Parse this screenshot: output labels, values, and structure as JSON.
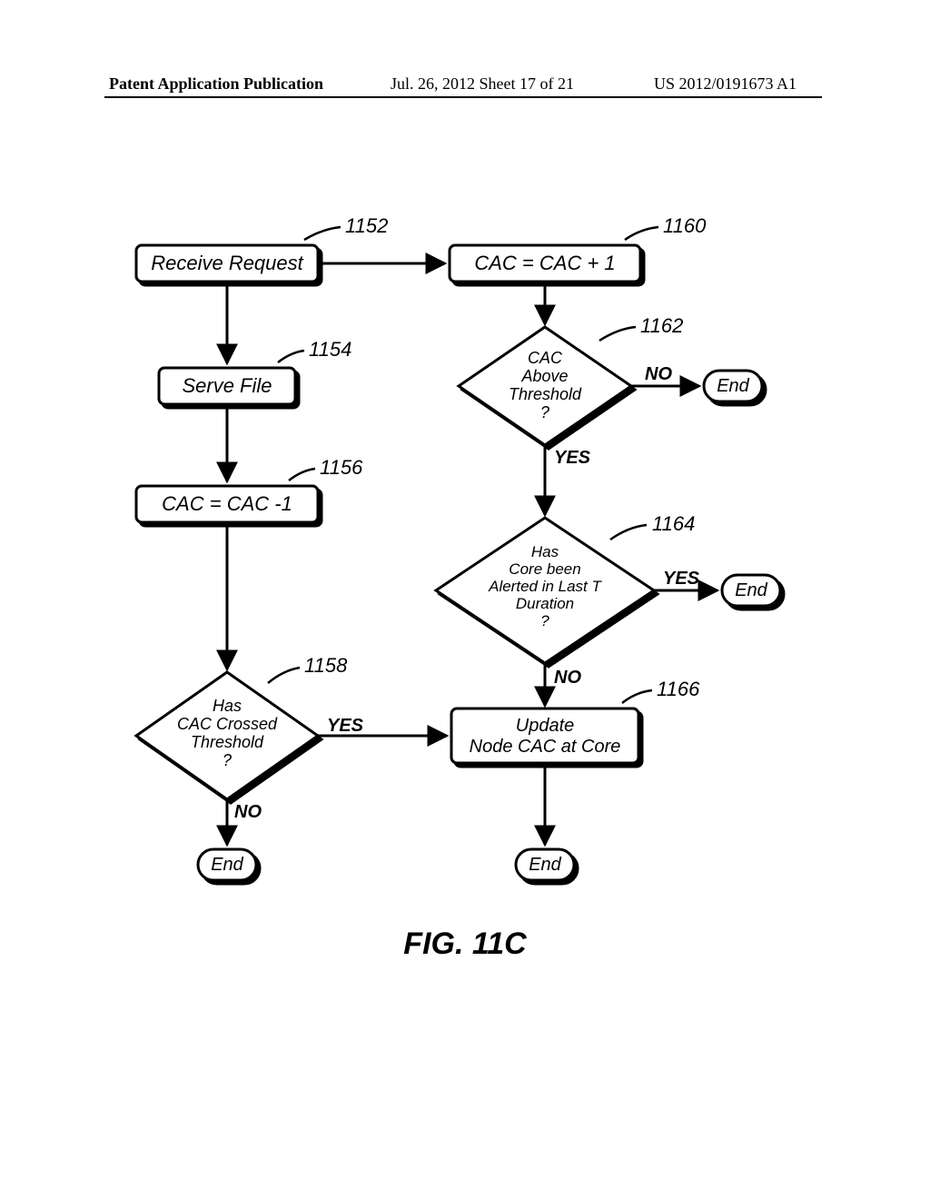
{
  "header": {
    "left": "Patent Application Publication",
    "mid": "Jul. 26, 2012  Sheet 17 of 21",
    "right": "US 2012/0191673 A1"
  },
  "figure_caption": "FIG. 11C",
  "labels": {
    "l1152": "1152",
    "l1154": "1154",
    "l1156": "1156",
    "l1158": "1158",
    "l1160": "1160",
    "l1162": "1162",
    "l1164": "1164",
    "l1166": "1166"
  },
  "nodes": {
    "receive_request": "Receive Request",
    "serve_file": "Serve File",
    "cac_minus": "CAC = CAC -1",
    "cac_plus": "CAC = CAC + 1",
    "d1158_l1": "Has",
    "d1158_l2": "CAC Crossed",
    "d1158_l3": "Threshold",
    "d1158_l4": "?",
    "d1162_l1": "CAC",
    "d1162_l2": "Above",
    "d1162_l3": "Threshold",
    "d1162_l4": "?",
    "d1164_l1": "Has",
    "d1164_l2": "Core been",
    "d1164_l3": "Alerted in Last T",
    "d1164_l4": "Duration",
    "d1164_l5": "?",
    "update_l1": "Update",
    "update_l2": "Node CAC at Core",
    "end": "End"
  },
  "edges": {
    "yes": "YES",
    "no": "NO"
  }
}
